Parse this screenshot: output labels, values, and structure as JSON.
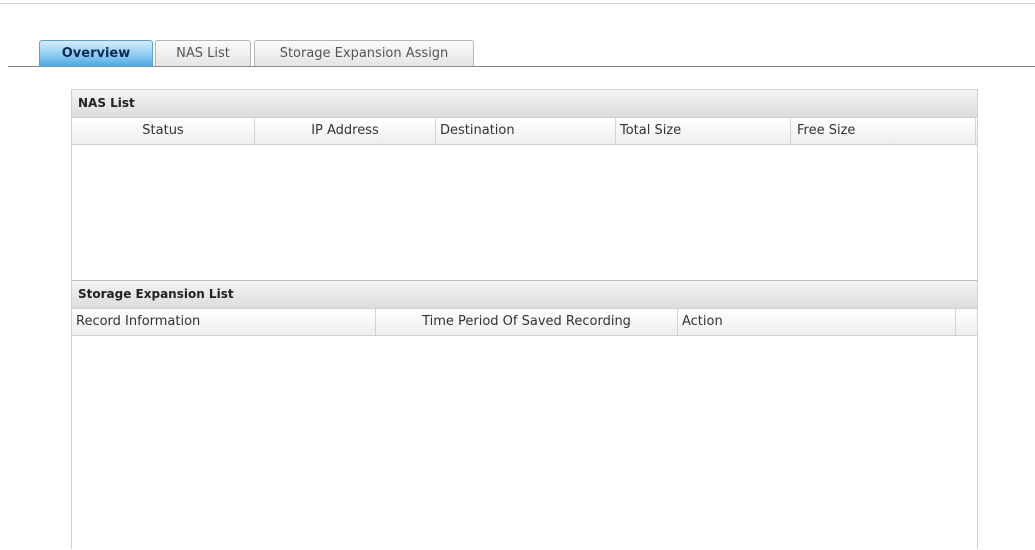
{
  "tabs": [
    {
      "label": "Overview",
      "active": true
    },
    {
      "label": "NAS List",
      "active": false
    },
    {
      "label": "Storage Expansion Assign",
      "active": false
    }
  ],
  "nas_section": {
    "title": "NAS List",
    "columns": [
      "Status",
      "IP Address",
      "Destination",
      "Total Size",
      "Free Size"
    ],
    "rows": []
  },
  "storage_section": {
    "title": "Storage Expansion List",
    "columns": [
      "Record Information",
      "Time Period Of Saved Recording",
      "Action"
    ],
    "rows": []
  },
  "colors": {
    "active_tab": "#4aa6e0",
    "header_bg": "#dcdcdc",
    "border": "#cfcfcf"
  }
}
